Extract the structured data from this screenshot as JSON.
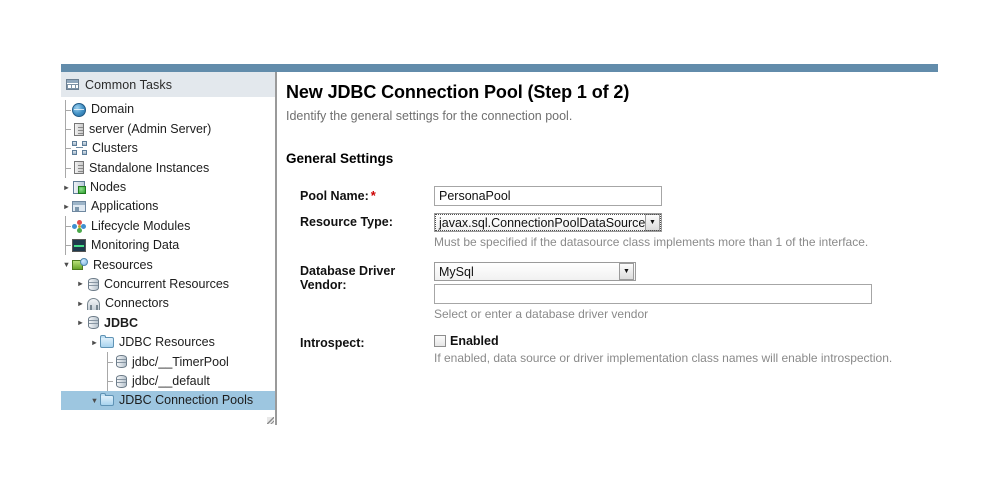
{
  "topbar": {
    "color": "#628cab"
  },
  "sidebar": {
    "header": {
      "icon": "grid-icon",
      "title": "Common Tasks"
    },
    "items": [
      {
        "label": "Domain",
        "icon": "globe-icon",
        "depth": 0,
        "twisty": "",
        "bold": false,
        "selected": false
      },
      {
        "label": "server (Admin Server)",
        "icon": "server-icon",
        "depth": 0,
        "twisty": "",
        "bold": false,
        "selected": false
      },
      {
        "label": "Clusters",
        "icon": "clusters-icon",
        "depth": 0,
        "twisty": "",
        "bold": false,
        "selected": false
      },
      {
        "label": "Standalone Instances",
        "icon": "server-icon",
        "depth": 0,
        "twisty": "",
        "bold": false,
        "selected": false
      },
      {
        "label": "Nodes",
        "icon": "nodes-icon",
        "depth": 0,
        "twisty": "collapsed",
        "bold": false,
        "selected": false
      },
      {
        "label": "Applications",
        "icon": "apps-icon",
        "depth": 0,
        "twisty": "collapsed",
        "bold": false,
        "selected": false
      },
      {
        "label": "Lifecycle Modules",
        "icon": "lifecycle-icon",
        "depth": 0,
        "twisty": "",
        "bold": false,
        "selected": false
      },
      {
        "label": "Monitoring Data",
        "icon": "monitor-icon",
        "depth": 0,
        "twisty": "",
        "bold": false,
        "selected": false
      },
      {
        "label": "Resources",
        "icon": "resources-icon",
        "depth": 0,
        "twisty": "expanded",
        "bold": false,
        "selected": false
      },
      {
        "label": "Concurrent Resources",
        "icon": "database-icon",
        "depth": 1,
        "twisty": "collapsed",
        "bold": false,
        "selected": false
      },
      {
        "label": "Connectors",
        "icon": "connector-icon",
        "depth": 1,
        "twisty": "collapsed",
        "bold": false,
        "selected": false
      },
      {
        "label": "JDBC",
        "icon": "database-icon",
        "depth": 1,
        "twisty": "collapsed",
        "bold": true,
        "selected": false
      },
      {
        "label": "JDBC Resources",
        "icon": "folder-icon",
        "depth": 2,
        "twisty": "collapsed",
        "bold": false,
        "selected": false
      },
      {
        "label": "jdbc/__TimerPool",
        "icon": "database-icon",
        "depth": 3,
        "twisty": "",
        "bold": false,
        "selected": false
      },
      {
        "label": "jdbc/__default",
        "icon": "database-icon",
        "depth": 3,
        "twisty": "",
        "bold": false,
        "selected": false
      },
      {
        "label": "JDBC Connection Pools",
        "icon": "folder-icon",
        "depth": 2,
        "twisty": "expanded",
        "bold": false,
        "selected": true
      }
    ]
  },
  "page": {
    "title": "New JDBC Connection Pool (Step 1 of 2)",
    "subtitle": "Identify the general settings for the connection pool.",
    "section_title": "General Settings"
  },
  "form": {
    "pool_name": {
      "label": "Pool Name:",
      "required_mark": "*",
      "value": "PersonaPool",
      "placeholder": ""
    },
    "resource_type": {
      "label": "Resource Type:",
      "value": "javax.sql.ConnectionPoolDataSource",
      "hint": "Must be specified if the datasource class implements more than 1 of the interface."
    },
    "database_driver_vendor": {
      "label": "Database Driver Vendor:",
      "value": "MySql",
      "text_value": "",
      "text_placeholder": "",
      "hint": "Select or enter a database driver vendor"
    },
    "introspect": {
      "label": "Introspect:",
      "checkbox_label": "Enabled",
      "checked": false,
      "hint": "If enabled, data source or driver implementation class names will enable introspection."
    }
  }
}
